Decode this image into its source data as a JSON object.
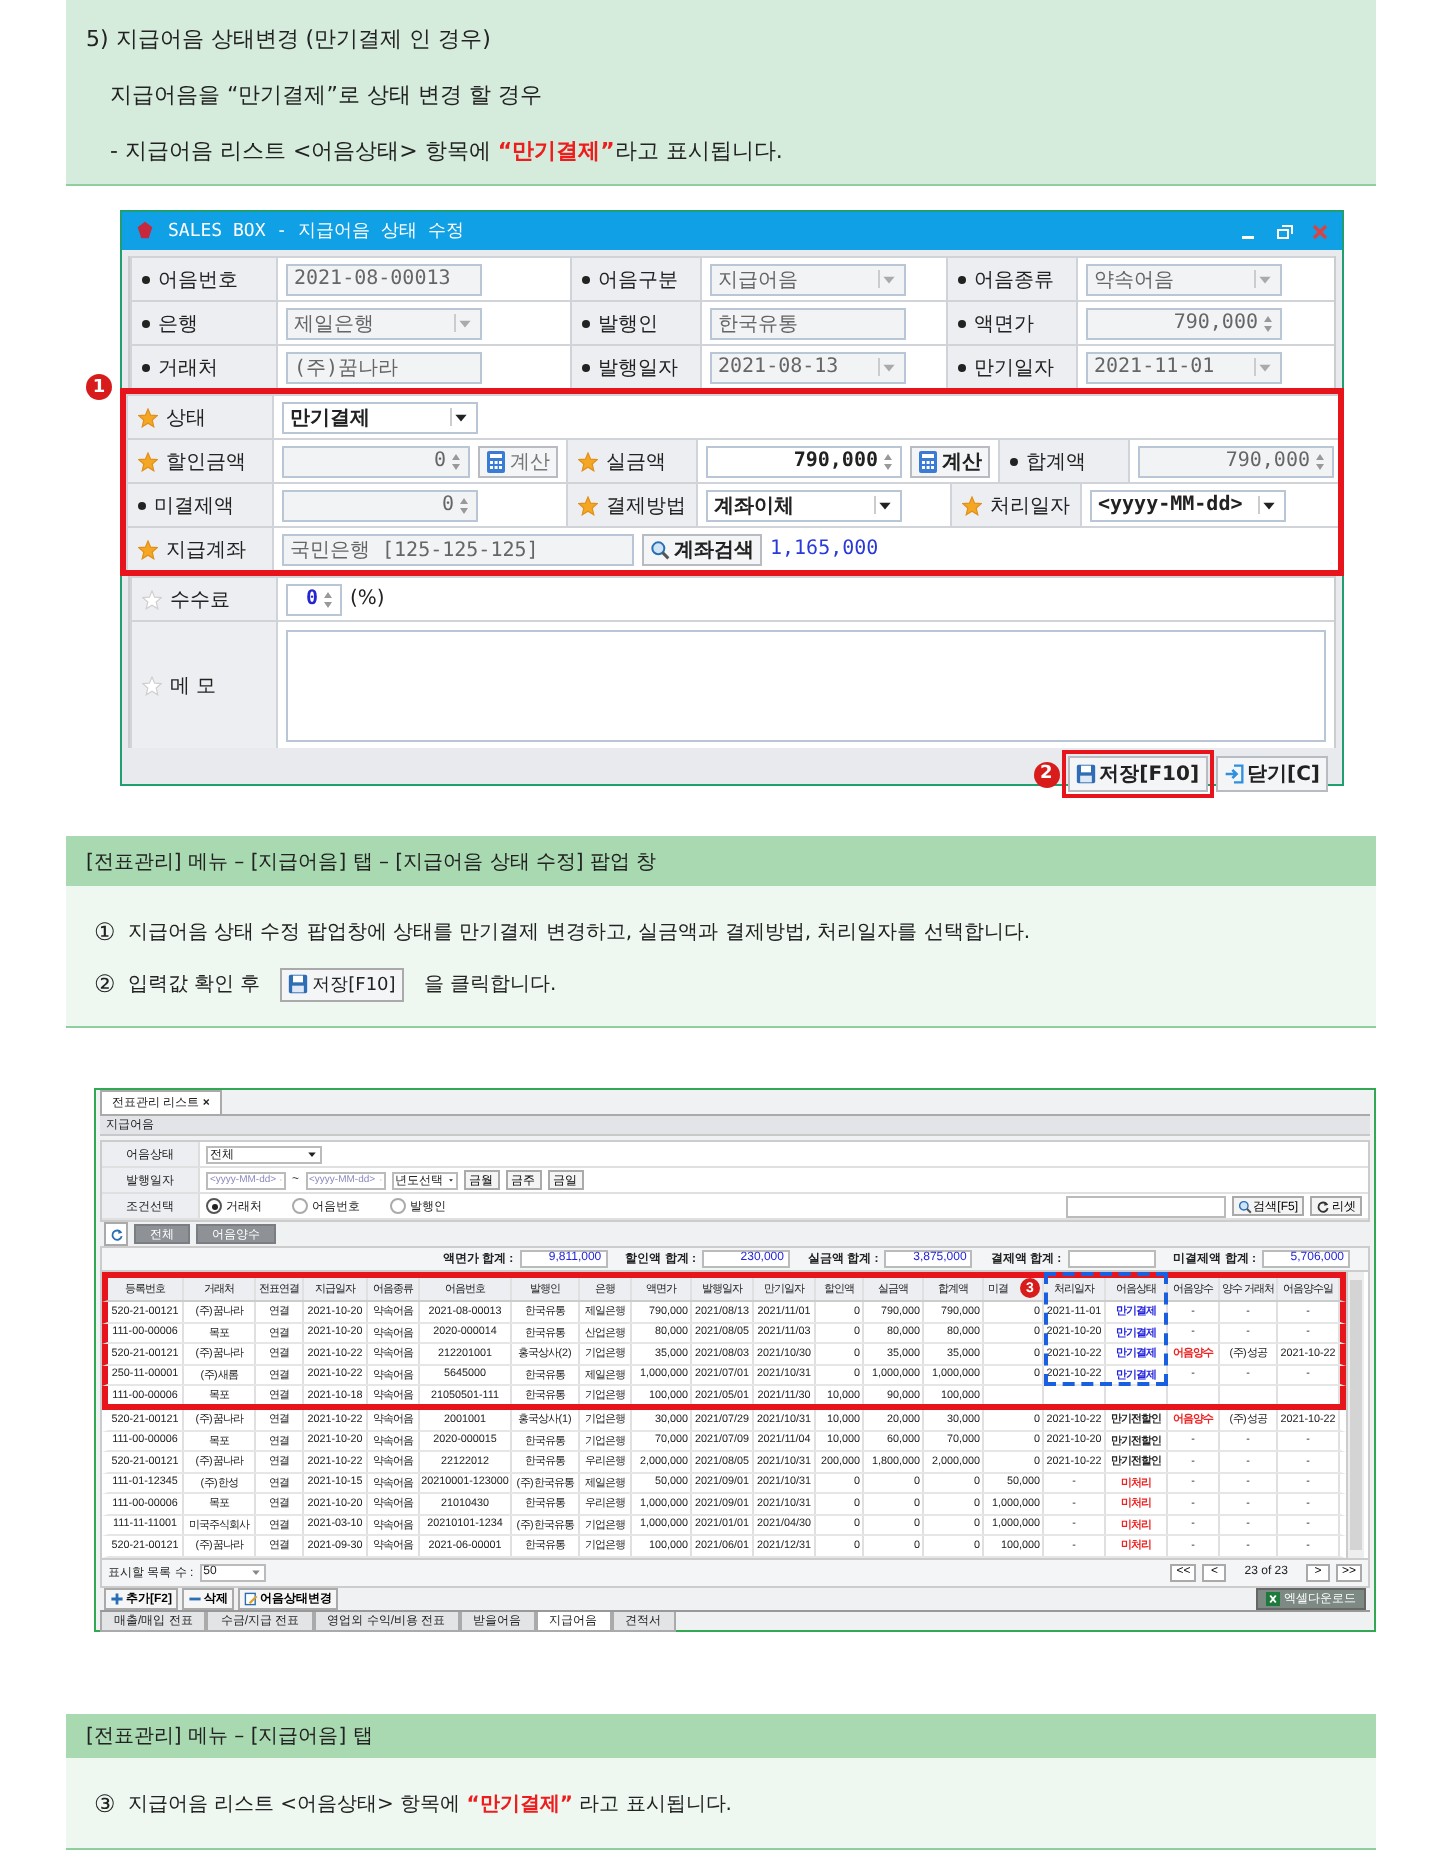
{
  "intro": {
    "title": "5) 지급어음 상태변경 (만기결제 인 경우)",
    "subtitle": "지급어음을 “만기결제”로 상태 변경 할 경우",
    "note": {
      "before": "- 지급어음 리스트 <어음상태> 항목에",
      "highlight": "“만기결제”",
      "after": "라고 표시됩니다."
    }
  },
  "dialog": {
    "title": "SALES BOX - 지급어음 상태 수정",
    "sections": [
      {
        "rows": [
          {
            "fields": [
              {
                "label": "어음번호",
                "kind": "bullet",
                "control": {
                  "kind": "text",
                  "value": "2021-08-00013",
                  "disabled": true
                }
              },
              {
                "label": "어음구분",
                "kind": "bullet",
                "control": {
                  "kind": "select",
                  "value": "지급어음",
                  "disabled": true
                }
              },
              {
                "label": "어음종류",
                "kind": "bullet",
                "control": {
                  "kind": "select",
                  "value": "약속어음",
                  "disabled": true
                }
              }
            ]
          },
          {
            "fields": [
              {
                "label": "은행",
                "kind": "bullet",
                "control": {
                  "kind": "select",
                  "value": "제일은행",
                  "disabled": true
                }
              },
              {
                "label": "발행인",
                "kind": "bullet",
                "control": {
                  "kind": "text",
                  "value": "한국유통",
                  "disabled": true
                }
              },
              {
                "label": "액면가",
                "kind": "bullet",
                "control": {
                  "kind": "spin",
                  "value": "790,000",
                  "disabled": true
                }
              }
            ]
          },
          {
            "fields": [
              {
                "label": "거래처",
                "kind": "bullet",
                "control": {
                  "kind": "text",
                  "value": "(주)꿈나라",
                  "disabled": true
                }
              },
              {
                "label": "발행일자",
                "kind": "bullet",
                "control": {
                  "kind": "select",
                  "value": "2021-08-13",
                  "disabled": true
                }
              },
              {
                "label": "만기일자",
                "kind": "bullet",
                "control": {
                  "kind": "select",
                  "value": "2021-11-01",
                  "disabled": true
                }
              }
            ]
          }
        ]
      },
      {
        "highlighted": true,
        "badge": "1",
        "rows": [
          {
            "fields": [
              {
                "label": "상태",
                "kind": "star",
                "control": {
                  "kind": "select",
                  "value": "만기결제",
                  "disabled": false
                }
              }
            ]
          },
          {
            "fields": [
              {
                "label": "할인금액",
                "kind": "star",
                "control": {
                  "kind": "spin",
                  "value": "0",
                  "disabled": true
                },
                "action": {
                  "label": "계산",
                  "disabled": true
                }
              },
              {
                "label": "실금액",
                "kind": "star",
                "control": {
                  "kind": "spin",
                  "value": "790,000",
                  "disabled": false
                },
                "action": {
                  "label": "계산",
                  "disabled": false
                }
              },
              {
                "label": "합계액",
                "kind": "bullet",
                "control": {
                  "kind": "spin",
                  "value": "790,000",
                  "disabled": true
                }
              }
            ]
          },
          {
            "fields": [
              {
                "label": "미결제액",
                "kind": "bullet",
                "control": {
                  "kind": "spin",
                  "value": "0",
                  "disabled": true
                }
              },
              {
                "label": "결제방법",
                "kind": "star",
                "control": {
                  "kind": "select",
                  "value": "계좌이체",
                  "disabled": false
                }
              },
              {
                "label": "처리일자",
                "kind": "star",
                "control": {
                  "kind": "select",
                  "value": "<yyyy-MM-dd>",
                  "disabled": false
                }
              }
            ]
          },
          {
            "fields": [
              {
                "label": "지급계좌",
                "kind": "star",
                "control": {
                  "kind": "text",
                  "value": "국민은행 [125-125-125]",
                  "disabled": true
                },
                "search": "계좌검색",
                "note": "1,165,000"
              }
            ]
          }
        ]
      },
      {
        "rows": [
          {
            "fields": [
              {
                "label": "수수료",
                "kind": "star_empty",
                "control": {
                  "kind": "spin",
                  "value": "0",
                  "disabled": false
                },
                "unit": "(%)"
              }
            ]
          },
          {
            "fields": [
              {
                "label": "메 모",
                "kind": "star_empty",
                "control": {
                  "kind": "textarea",
                  "disabled": false
                }
              }
            ]
          }
        ]
      }
    ],
    "buttons": [
      {
        "label": "저장[F10]",
        "kind": "save",
        "highlighted": true,
        "badge": "2"
      },
      {
        "label": "닫기[C]",
        "kind": "close",
        "highlighted": false
      }
    ]
  },
  "caption": {
    "title": "[전표관리] 메뉴 – [지급어음] 탭 – [지급어음 상태 수정] 팝업 창",
    "steps": [
      {
        "number": "①",
        "text": "지급어음 상태 수정 팝업창에 상태를 만기결제 변경하고, 실금액과 결제방법, 처리일자를 선택합니다."
      },
      {
        "number": "②",
        "before": "입력값 확인 후",
        "button": "저장[F10]",
        "after": "을 클릭합니다."
      }
    ]
  },
  "list": {
    "tab": "전표관리 리스트",
    "tab_close": "×",
    "panel_title": "지급어음",
    "filters": {
      "status": {
        "label": "어음상태",
        "value": "전체"
      },
      "date": {
        "label": "발행일자",
        "from": "<yyyy-MM-dd>",
        "sep": "~",
        "to": "<yyyy-MM-dd>",
        "year": "년도선택",
        "quick": [
          "금월",
          "금주",
          "금일"
        ]
      },
      "condition": {
        "label": "조건선택",
        "options": [
          {
            "label": "거래처",
            "selected": true
          },
          {
            "label": "어음번호",
            "selected": false
          },
          {
            "label": "발행인",
            "selected": false
          }
        ],
        "search_button": "검색[F5]",
        "reset_button": "리셋"
      }
    },
    "toolbar": [
      "전체",
      "어음양수"
    ],
    "totals": [
      {
        "label": "액면가 합계 :",
        "value": "9,811,000"
      },
      {
        "label": "할인액 합계 :",
        "value": "230,000"
      },
      {
        "label": "실금액 합계 :",
        "value": "3,875,000"
      },
      {
        "label": "결제액 합계 :"
      },
      {
        "label": "미결제액 합계 :",
        "value": "5,706,000"
      }
    ],
    "badge": "3",
    "columns": [
      "등록번호",
      "거래처",
      "전표연결",
      "지급일자",
      "어음종류",
      "어음번호",
      "발행인",
      "은행",
      "액면가",
      "발행일자",
      "만기일자",
      "할인액",
      "실금액",
      "합계액",
      "미결",
      "처리일자",
      "어음상태",
      "어음양수",
      "양수 거래처",
      "어음양수일"
    ],
    "rows": [
      {
        "highlighted": true,
        "color": "#2222dd",
        "transferred": false,
        "cells": [
          "520-21-00121",
          "(주)꿈나라",
          "연결",
          "2021-10-20",
          "약속어음",
          "2021-08-00013",
          "한국유통",
          "제일은행",
          "790,000",
          "2021/08/13",
          "2021/11/01",
          "0",
          "790,000",
          "790,000",
          "0",
          "2021-11-01",
          "만기결제",
          "-",
          "-",
          "-"
        ]
      },
      {
        "highlighted": true,
        "color": "#2222dd",
        "transferred": false,
        "cells": [
          "111-00-00006",
          "목포",
          "연결",
          "2021-10-20",
          "약속어음",
          "2020-000014",
          "한국유통",
          "산업은행",
          "80,000",
          "2021/08/05",
          "2021/11/03",
          "0",
          "80,000",
          "80,000",
          "0",
          "2021-10-20",
          "만기결제",
          "-",
          "-",
          "-"
        ]
      },
      {
        "highlighted": true,
        "color": "#2222dd",
        "transferred": true,
        "cells": [
          "520-21-00121",
          "(주)꿈나라",
          "연결",
          "2021-10-22",
          "약속어음",
          "212201001",
          "홍국상사(2)",
          "기업은행",
          "35,000",
          "2021/08/03",
          "2021/10/30",
          "0",
          "35,000",
          "35,000",
          "0",
          "2021-10-22",
          "만기결제",
          "어음양수",
          "(주)성공",
          "2021-10-22"
        ]
      },
      {
        "highlighted": true,
        "color": "#2222dd",
        "transferred": false,
        "cells": [
          "250-11-00001",
          "(주)새롬",
          "연결",
          "2021-10-22",
          "약속어음",
          "5645000",
          "한국유통",
          "제일은행",
          "1,000,000",
          "2021/07/01",
          "2021/10/31",
          "0",
          "1,000,000",
          "1,000,000",
          "0",
          "2021-10-22",
          "만기결제",
          "-",
          "-",
          "-"
        ]
      },
      {
        "highlighted": true,
        "cells": [
          "111-00-00006",
          "목포",
          "연결",
          "2021-10-18",
          "약속어음",
          "21050501-111",
          "한국유통",
          "기업은행",
          "100,000",
          "2021/05/01",
          "2021/11/30",
          "10,000",
          "90,000",
          "100,000"
        ]
      },
      {
        "highlighted": false,
        "color": "#222222",
        "transferred": true,
        "cells": [
          "520-21-00121",
          "(주)꿈나라",
          "연결",
          "2021-10-22",
          "약속어음",
          "2001001",
          "홍국상사(1)",
          "기업은행",
          "30,000",
          "2021/07/29",
          "2021/10/31",
          "10,000",
          "20,000",
          "30,000",
          "0",
          "2021-10-22",
          "만기전할인",
          "어음양수",
          "(주)성공",
          "2021-10-22"
        ]
      },
      {
        "highlighted": false,
        "color": "#222222",
        "transferred": false,
        "cells": [
          "111-00-00006",
          "목포",
          "연결",
          "2021-10-20",
          "약속어음",
          "2020-000015",
          "한국유통",
          "기업은행",
          "70,000",
          "2021/07/09",
          "2021/11/04",
          "10,000",
          "60,000",
          "70,000",
          "0",
          "2021-10-20",
          "만기전할인",
          "-",
          "-",
          "-"
        ]
      },
      {
        "highlighted": false,
        "color": "#222222",
        "transferred": false,
        "cells": [
          "520-21-00121",
          "(주)꿈나라",
          "연결",
          "2021-10-22",
          "약속어음",
          "22122012",
          "한국유통",
          "우리은행",
          "2,000,000",
          "2021/08/05",
          "2021/10/31",
          "200,000",
          "1,800,000",
          "2,000,000",
          "0",
          "2021-10-22",
          "만기전할인",
          "-",
          "-",
          "-"
        ]
      },
      {
        "highlighted": false,
        "color": "#ee2222",
        "transferred": false,
        "cells": [
          "111-01-12345",
          "(주)한성",
          "연결",
          "2021-10-15",
          "약속어음",
          "20210001-123000",
          "(주)한국유통",
          "제일은행",
          "50,000",
          "2021/09/01",
          "2021/10/31",
          "0",
          "0",
          "0",
          "50,000",
          "-",
          "미처리",
          "-",
          "-",
          "-"
        ]
      },
      {
        "highlighted": false,
        "color": "#ee2222",
        "transferred": false,
        "cells": [
          "111-00-00006",
          "목포",
          "연결",
          "2021-10-20",
          "약속어음",
          "21010430",
          "한국유통",
          "우리은행",
          "1,000,000",
          "2021/09/01",
          "2021/10/31",
          "0",
          "0",
          "0",
          "1,000,000",
          "-",
          "미처리",
          "-",
          "-",
          "-"
        ]
      },
      {
        "highlighted": false,
        "color": "#ee2222",
        "transferred": false,
        "cells": [
          "111-11-11001",
          "미국주식회사",
          "연결",
          "2021-03-10",
          "약속어음",
          "20210101-1234",
          "(주)한국유통",
          "기업은행",
          "1,000,000",
          "2021/01/01",
          "2021/04/30",
          "0",
          "0",
          "0",
          "1,000,000",
          "-",
          "미처리",
          "-",
          "-",
          "-"
        ]
      },
      {
        "highlighted": false,
        "color": "#ee2222",
        "transferred": false,
        "cells": [
          "520-21-00121",
          "(주)꿈나라",
          "연결",
          "2021-09-30",
          "약속어음",
          "2021-06-00001",
          "한국유통",
          "기업은행",
          "100,000",
          "2021/06/01",
          "2021/12/31",
          "0",
          "0",
          "0",
          "100,000",
          "-",
          "미처리",
          "-",
          "-",
          "-"
        ]
      }
    ],
    "page_size": {
      "label": "표시할 목록 수 :",
      "value": "50"
    },
    "pager": {
      "first": "<<",
      "prev": "<",
      "info": "23 of 23",
      "next": ">",
      "last": ">>"
    },
    "actions": [
      {
        "label": "추가[F2]",
        "kind": "add"
      },
      {
        "label": "삭제",
        "kind": "delete"
      },
      {
        "label": "어음상태변경",
        "kind": "edit"
      }
    ],
    "excel": "엑셀다운로드",
    "tabs": [
      {
        "label": "매출/매입 전표",
        "selected": false
      },
      {
        "label": "수금/지급 전표",
        "selected": false
      },
      {
        "label": "영업외 수익/비용 전표",
        "selected": false
      },
      {
        "label": "받을어음",
        "selected": false
      },
      {
        "label": "지급어음",
        "selected": true
      },
      {
        "label": "견적서",
        "selected": false
      }
    ]
  },
  "caption2": {
    "title": "[전표관리] 메뉴 – [지급어음] 탭",
    "step": {
      "number": "③",
      "before": "지급어음 리스트 <어음상태> 항목에",
      "highlight": "“만기결제”",
      "after": "라고 표시됩니다."
    }
  }
}
